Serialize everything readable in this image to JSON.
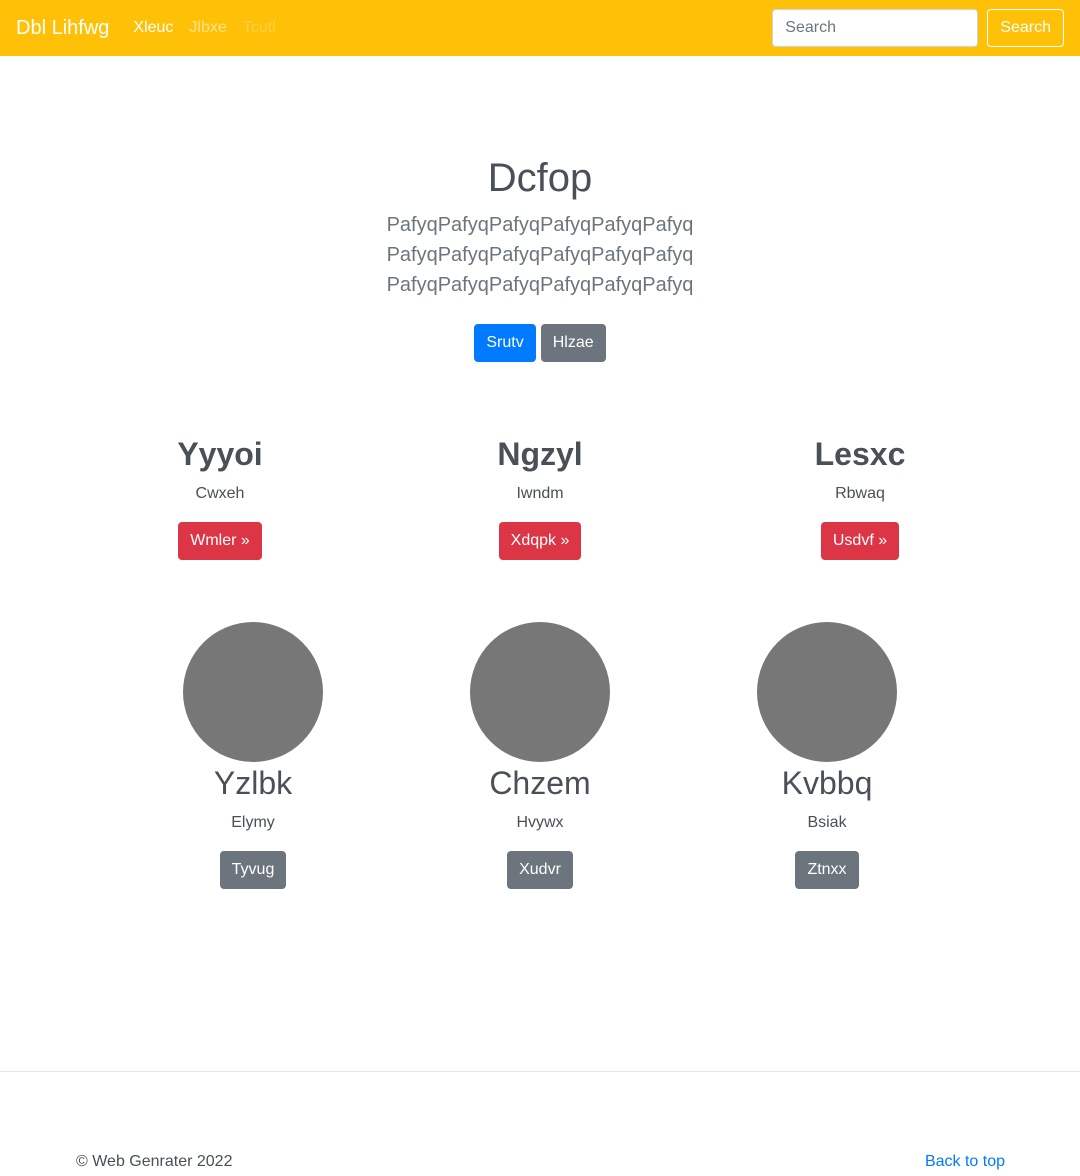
{
  "navbar": {
    "brand": "Dbl Lihfwg",
    "links": [
      {
        "label": "Xleuc",
        "state": "active"
      },
      {
        "label": "Jlbxe",
        "state": "muted"
      },
      {
        "label": "Tcutl",
        "state": "disabled"
      }
    ],
    "search": {
      "placeholder": "Search",
      "value": "",
      "button_label": "Search"
    }
  },
  "hero": {
    "title": "Dcfop",
    "lead": "PafyqPafyqPafyqPafyqPafyqPafyq PafyqPafyqPafyqPafyqPafyqPafyq PafyqPafyqPafyqPafyqPafyqPafyq",
    "primary_button": "Srutv",
    "secondary_button": "Hlzae"
  },
  "features": [
    {
      "title": "Yyyoi",
      "text": "Cwxeh",
      "button": "Wmler »"
    },
    {
      "title": "Ngzyl",
      "text": "Iwndm",
      "button": "Xdqpk »"
    },
    {
      "title": "Lesxc",
      "text": "Rbwaq",
      "button": "Usdvf »"
    }
  ],
  "profiles": [
    {
      "title": "Yzlbk",
      "text": "Elymy",
      "button": "Tyvug"
    },
    {
      "title": "Chzem",
      "text": "Hvywx",
      "button": "Xudvr"
    },
    {
      "title": "Kvbbq",
      "text": "Bsiak",
      "button": "Ztnxx"
    }
  ],
  "footer": {
    "copyright": "© Web Genrater 2022",
    "back_to_top": "Back to top"
  },
  "colors": {
    "navbar": "#ffc107",
    "primary": "#007bff",
    "secondary": "#6c757d",
    "danger": "#dc3545",
    "avatar": "#777777"
  }
}
